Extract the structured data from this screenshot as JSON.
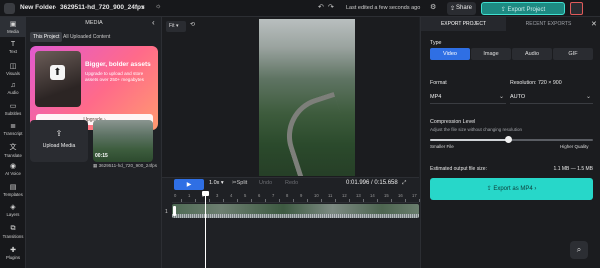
{
  "topbar": {
    "folder": "New Folder",
    "separator": "›",
    "project_name": "3629511-hd_720_900_24fps",
    "last_edited": "Last edited a few seconds ago",
    "share_label": "Share",
    "export_label": "Export Project"
  },
  "rail": {
    "items": [
      {
        "label": "Media",
        "icon": "media-icon"
      },
      {
        "label": "Text",
        "icon": "text-icon"
      },
      {
        "label": "Visuals",
        "icon": "visuals-icon"
      },
      {
        "label": "Audio",
        "icon": "audio-icon"
      },
      {
        "label": "Subtitles",
        "icon": "subtitles-icon"
      },
      {
        "label": "Transcript",
        "icon": "transcript-icon"
      },
      {
        "label": "Translate",
        "icon": "translate-icon"
      },
      {
        "label": "AI Voice",
        "icon": "ai-voice-icon"
      },
      {
        "label": "Templates",
        "icon": "templates-icon"
      },
      {
        "label": "Layers",
        "icon": "layers-icon"
      },
      {
        "label": "Transitions",
        "icon": "transitions-icon"
      },
      {
        "label": "Plugins",
        "icon": "plugins-icon"
      }
    ]
  },
  "media": {
    "header": "MEDIA",
    "tabs": [
      "This Project",
      "All Uploaded Content"
    ],
    "upgrade": {
      "title": "Bigger, bolder assets",
      "description": "Upgrade to upload and store assets over 250+ megabytes",
      "button": "Upgrade ›"
    },
    "upload_label": "Upload Media",
    "thumb_duration": "00:15",
    "thumb_name": "3629511-hd_720_900_24fps"
  },
  "preview": {
    "fit_label": "Fit ▾"
  },
  "timeline": {
    "speed": "1.0x",
    "split": "Split",
    "dim1": "Undo",
    "dim2": "Redo",
    "timecode": "0:01.996 / 0:15.658",
    "track_number": "1",
    "ticks": [
      "0",
      "1",
      "2",
      "3",
      "4",
      "5",
      "6",
      "7",
      "8",
      "9",
      "10",
      "11",
      "12",
      "13",
      "14",
      "15",
      "16",
      "17"
    ]
  },
  "export": {
    "tabs": [
      "EXPORT PROJECT",
      "RECENT EXPORTS"
    ],
    "type_label": "Type",
    "types": [
      "Video",
      "Image",
      "Audio",
      "GIF"
    ],
    "active_type": "Video",
    "format_label": "Format",
    "format_value": "MP4",
    "resolution_label": "Resolution: 720 × 900",
    "resolution_value": "AUTO",
    "compression_label": "Compression Level",
    "compression_sub": "Adjust the file size without changing resolution",
    "smaller_label": "Smaller File",
    "higher_label": "Higher Quality",
    "compression_level": 0.48,
    "estimate_label": "Estimated output file size:",
    "estimate_value": "1.1 MB — 1.5 MB",
    "export_button": "Export as MP4 ›"
  },
  "colors": {
    "accent_teal": "#27d7c9",
    "accent_blue": "#2f6fe4",
    "panel_bg": "#1f2125"
  }
}
